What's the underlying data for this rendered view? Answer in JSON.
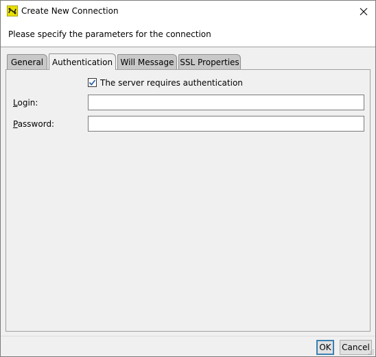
{
  "window": {
    "title": "Create New Connection",
    "header_text": "Please specify the parameters for the connection"
  },
  "tabs": [
    {
      "label": "General",
      "active": false
    },
    {
      "label": "Authentication",
      "active": true
    },
    {
      "label": "Will Message",
      "active": false
    },
    {
      "label": "SSL Properties",
      "active": false
    }
  ],
  "auth": {
    "requires_auth_label": "The server requires authentication",
    "requires_auth_checked": true,
    "login_label_mnemonic": "L",
    "login_label_rest": "ogin:",
    "login_value": "",
    "password_label_mnemonic": "P",
    "password_label_rest": "assword:",
    "password_value": ""
  },
  "buttons": {
    "ok": "OK",
    "cancel": "Cancel"
  },
  "colors": {
    "checkbox_check": "#2b5fa8",
    "default_button_border": "#3c7fb1"
  }
}
